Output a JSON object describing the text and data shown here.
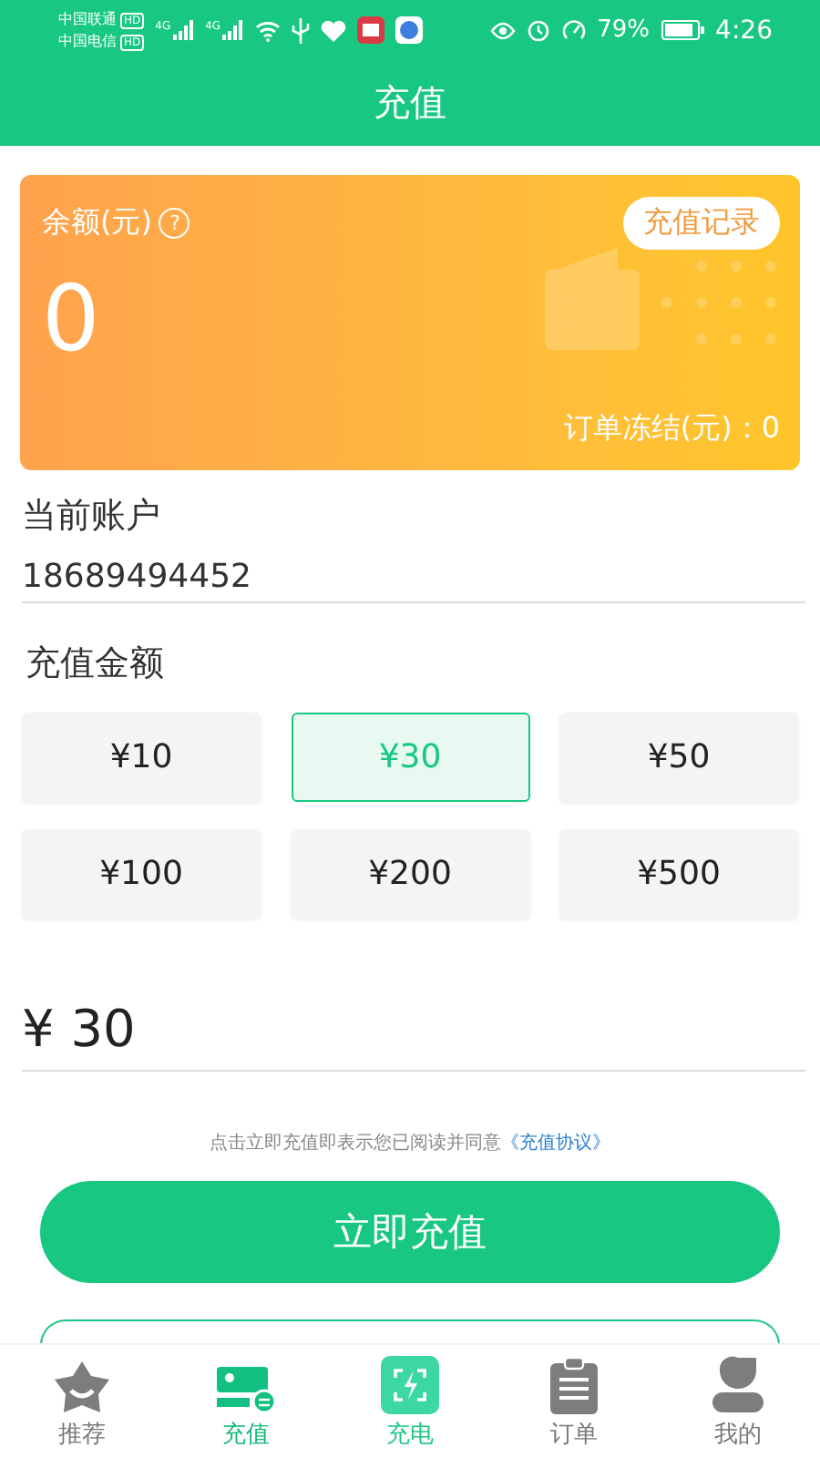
{
  "status_bar": {
    "carriers": [
      {
        "name": "中国联通",
        "badge": "HD"
      },
      {
        "name": "中国电信",
        "badge": "HD"
      }
    ],
    "network": [
      "4G",
      "4G"
    ],
    "battery_percent": "79%",
    "time": "4:26"
  },
  "header": {
    "title": "充值"
  },
  "balance_card": {
    "label": "余额(元)",
    "help_icon": "?",
    "history_button": "充值记录",
    "balance": "0",
    "frozen": "订单冻结(元)：0"
  },
  "account": {
    "label": "当前账户",
    "value": "18689494452"
  },
  "amounts": {
    "label": "充值金额",
    "options": [
      {
        "label": "¥10",
        "selected": false
      },
      {
        "label": "¥30",
        "selected": true
      },
      {
        "label": "¥50",
        "selected": false
      },
      {
        "label": "¥100",
        "selected": false
      },
      {
        "label": "¥200",
        "selected": false
      },
      {
        "label": "¥500",
        "selected": false
      }
    ],
    "custom_value": "¥ 30"
  },
  "agreement": {
    "text": "点击立即充值即表示您已阅读并同意",
    "link": "《充值协议》"
  },
  "submit_button": "立即充值",
  "tabs": [
    {
      "label": "推荐",
      "kind": "star",
      "selected": false
    },
    {
      "label": "充值",
      "kind": "card",
      "selected": true
    },
    {
      "label": "充电",
      "kind": "charge",
      "selected": false
    },
    {
      "label": "订单",
      "kind": "clipboard",
      "selected": false
    },
    {
      "label": "我的",
      "kind": "person",
      "selected": false
    }
  ]
}
